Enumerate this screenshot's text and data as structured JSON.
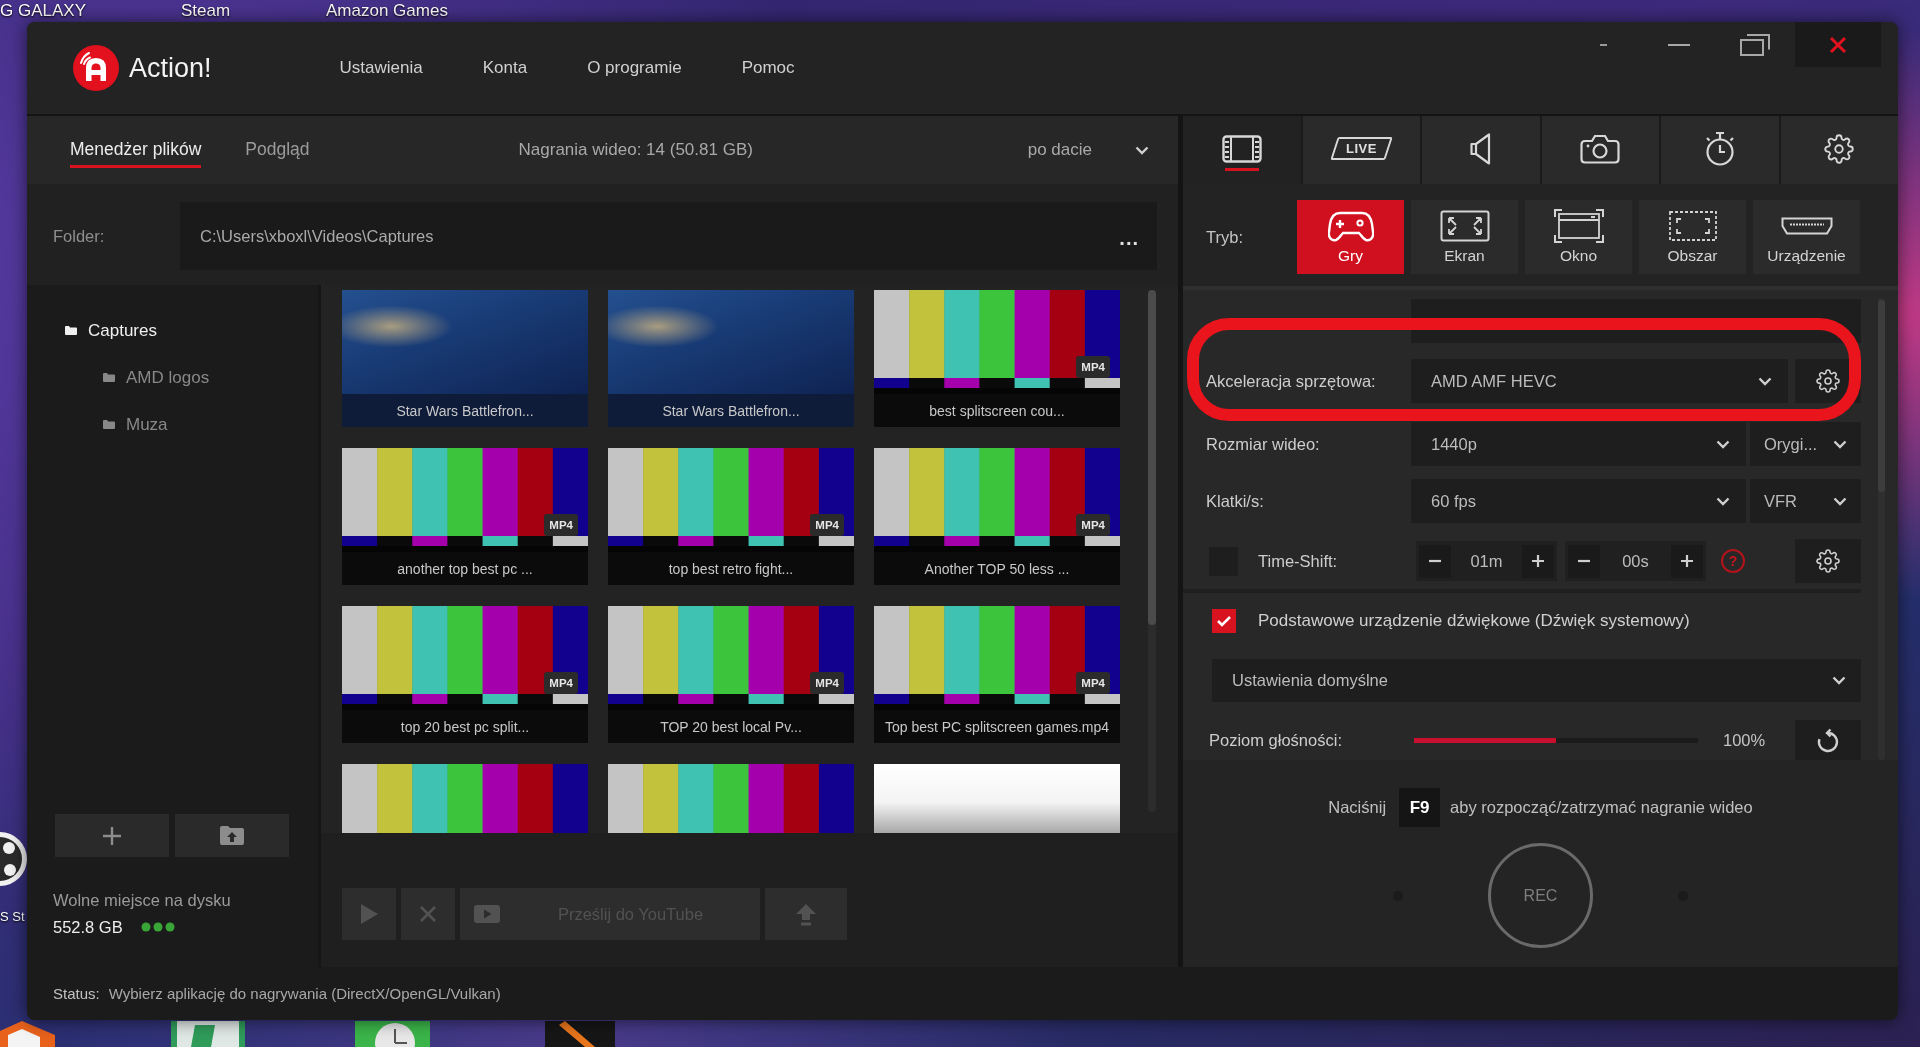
{
  "desktop": {
    "shortcuts": [
      {
        "label": "G GALAXY"
      },
      {
        "label": "Steam"
      },
      {
        "label": "Amazon Games"
      },
      {
        "label": "S St"
      }
    ]
  },
  "window": {
    "app_name": "Action!",
    "menu": [
      {
        "label": "Ustawienia"
      },
      {
        "label": "Konta"
      },
      {
        "label": "O programie"
      },
      {
        "label": "Pomoc"
      }
    ]
  },
  "file_manager": {
    "tabs": [
      {
        "label": "Menedżer plików",
        "selected": true
      },
      {
        "label": "Podgląd",
        "selected": false
      }
    ],
    "summary": "Nagrania wideo: 14 (50.81 GB)",
    "sort": {
      "value": "po dacie"
    },
    "folder": {
      "label": "Folder:",
      "path": "C:\\Users\\xboxl\\Videos\\Captures",
      "more": "..."
    },
    "tree": [
      {
        "label": "Captures",
        "selected": true,
        "children": [
          {
            "label": "AMD logos",
            "selected": false
          },
          {
            "label": "Muza",
            "selected": false
          }
        ]
      }
    ],
    "tree_buttons": [
      {
        "kind": "add"
      },
      {
        "kind": "import"
      }
    ],
    "disk": {
      "label": "Wolne miejsce na dysku",
      "value": "552.8 GB"
    },
    "videos": [
      {
        "kind": "photo",
        "title": "Star Wars Battlefron..."
      },
      {
        "kind": "photo",
        "title": "Star Wars Battlefron..."
      },
      {
        "kind": "bars",
        "title": "best splitscreen cou...",
        "badge": "MP4"
      },
      {
        "kind": "bars",
        "title": "another top best pc ...",
        "badge": "MP4"
      },
      {
        "kind": "bars",
        "title": "top best retro fight...",
        "badge": "MP4"
      },
      {
        "kind": "bars",
        "title": "Another TOP 50 less ...",
        "badge": "MP4"
      },
      {
        "kind": "bars",
        "title": "top 20 best pc split...",
        "badge": "MP4"
      },
      {
        "kind": "bars",
        "title": "TOP 20 best local Pv...",
        "badge": "MP4"
      },
      {
        "kind": "bars",
        "title": "Top best PC splitscreen games.mp4",
        "badge": "MP4"
      },
      {
        "kind": "bars"
      },
      {
        "kind": "bars"
      },
      {
        "kind": "blank"
      }
    ],
    "actions": [
      {
        "kind": "play",
        "disabled": true
      },
      {
        "kind": "delete",
        "disabled": true
      },
      {
        "kind": "youtube",
        "label": "Prześlij do YouTube",
        "disabled": true
      },
      {
        "kind": "upload",
        "disabled": true
      }
    ]
  },
  "recording_panel": {
    "tabs": [
      {
        "kind": "video",
        "selected": true
      },
      {
        "kind": "live",
        "label": "LIVE",
        "selected": false
      },
      {
        "kind": "audio",
        "selected": false
      },
      {
        "kind": "screenshot",
        "selected": false
      },
      {
        "kind": "timer",
        "selected": false
      },
      {
        "kind": "settings",
        "selected": false
      }
    ],
    "mode_label": "Tryb:",
    "modes": [
      {
        "kind": "games",
        "label": "Gry",
        "selected": true
      },
      {
        "kind": "screen",
        "label": "Ekran",
        "selected": false
      },
      {
        "kind": "window",
        "label": "Okno",
        "selected": false
      },
      {
        "kind": "region",
        "label": "Obszar",
        "selected": false
      },
      {
        "kind": "device",
        "label": "Urządzenie",
        "selected": false
      }
    ],
    "settings": [
      {
        "kind": "covered",
        "gear": false,
        "highlight": false
      },
      {
        "kind": "dropdown",
        "label": "Akceleracja sprzętowa:",
        "value": "AMD AMF HEVC",
        "gear": true,
        "highlight": true
      },
      {
        "kind": "dual",
        "label": "Rozmiar wideo:",
        "value": "1440p",
        "value_2": "Orygi...",
        "gear": false,
        "highlight": false
      },
      {
        "kind": "dual",
        "label": "Klatki/s:",
        "value": "60 fps",
        "value_2": "VFR",
        "gear": false,
        "highlight": false
      },
      {
        "kind": "timeshift",
        "label": "Time-Shift:",
        "checked": false,
        "minutes": "01m",
        "seconds": "00s",
        "help": "?",
        "gear": true,
        "highlight": false
      }
    ],
    "audio": {
      "label": "Podstawowe urządzenie dźwiękowe (Dźwięk systemowy)",
      "checked": true,
      "preset": "Ustawienia domyślne",
      "volume_label": "Poziom głośności:",
      "level": 0.5,
      "reading": "100%"
    },
    "hotkey": {
      "before": "Naciśnij",
      "key": "F9",
      "after": "aby rozpocząć/zatrzymać nagranie wideo"
    },
    "rec": "REC"
  },
  "status_bar": {
    "label": "Status:",
    "text": "Wybierz aplikację do nagrywania (DirectX/OpenGL/Vulkan)"
  }
}
